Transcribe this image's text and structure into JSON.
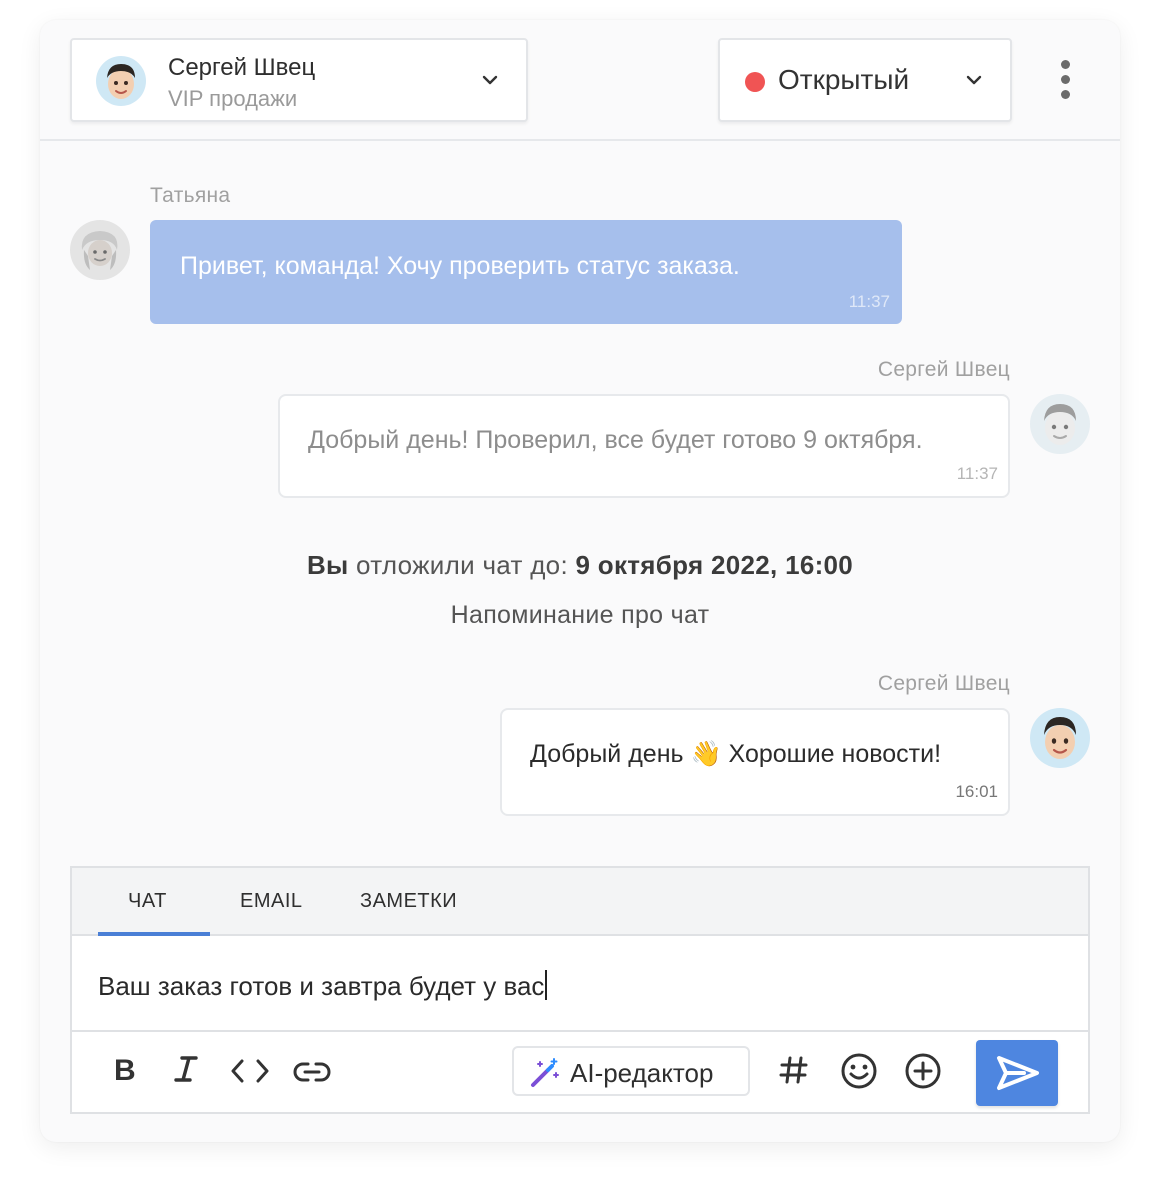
{
  "header": {
    "agent": {
      "name": "Сергей Швец",
      "team": "VIP продажи",
      "avatar_icon": "memoji-man-avatar"
    },
    "status": {
      "label": "Открытый",
      "color": "#f05454"
    },
    "menu_icon": "kebab-menu-icon"
  },
  "messages": [
    {
      "sender": "Татьяна",
      "text": "Привет, команда! Хочу проверить статус заказа.",
      "time": "11:37",
      "direction": "incoming",
      "bubble_color": "#a6bfec"
    },
    {
      "sender": "Сергей Швец",
      "text": "Добрый день! Проверил, все будет готово 9 октября.",
      "time": "11:37",
      "direction": "outgoing",
      "state": "faded"
    },
    {
      "sender": "Сергей Швец",
      "text": "Добрый день 👋 Хорошие новости!",
      "time": "16:01",
      "direction": "outgoing",
      "state": "normal"
    }
  ],
  "snooze": {
    "actor": "Вы",
    "action": " отложили чат до: ",
    "until": "9 октября 2022, 16:00"
  },
  "reminder": "Напоминание про чат",
  "composer": {
    "tabs": [
      {
        "label": "ЧАТ",
        "active": true
      },
      {
        "label": "EMAIL",
        "active": false
      },
      {
        "label": "ЗАМЕТКИ",
        "active": false
      }
    ],
    "input_value": "Ваш заказ готов и завтра будет у вас",
    "toolbar": {
      "tools": [
        "bold-icon",
        "italic-icon",
        "code-icon",
        "link-icon"
      ],
      "ai_label": "AI-редактор",
      "extras": [
        "hashtag-icon",
        "emoji-icon",
        "add-circle-icon"
      ],
      "send_icon": "send-icon",
      "accent": "#4e86e0"
    }
  }
}
